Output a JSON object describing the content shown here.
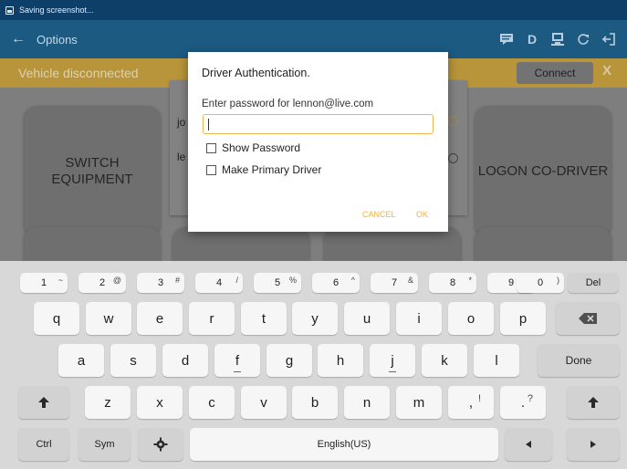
{
  "status_bar": {
    "text": "Saving screenshot..."
  },
  "app_bar": {
    "back_glyph": "←",
    "title": "Options",
    "actions": [
      "message-icon",
      "D",
      "eld-icon",
      "refresh-icon",
      "logout-icon"
    ],
    "d_label": "D"
  },
  "alert_bar": {
    "message": "Vehicle disconnected",
    "connect_label": "Connect",
    "close_label": "X"
  },
  "tiles": {
    "switch_equipment": "SWITCH\nEQUIPMENT",
    "logon_codriver": "LOGON CO-DRIVER"
  },
  "background_list": {
    "item1_fragment": "jo",
    "item2_fragment": "le"
  },
  "dialog": {
    "title": "Driver Authentication.",
    "prompt": "Enter password for lennon@live.com",
    "password_value": "",
    "show_password_label": "Show Password",
    "primary_driver_label": "Make Primary Driver",
    "cancel_label": "CANCEL",
    "ok_label": "OK"
  },
  "keyboard": {
    "row1": [
      {
        "k": "1",
        "s": "~"
      },
      {
        "k": "2",
        "s": "@"
      },
      {
        "k": "3",
        "s": "#"
      },
      {
        "k": "4",
        "s": "/"
      },
      {
        "k": "5",
        "s": "%"
      },
      {
        "k": "6",
        "s": "^"
      },
      {
        "k": "7",
        "s": "&"
      },
      {
        "k": "8",
        "s": "*"
      },
      {
        "k": "9",
        "s": "("
      },
      {
        "k": "0",
        "s": ")"
      }
    ],
    "del_label": "Del",
    "row2": [
      "q",
      "w",
      "e",
      "r",
      "t",
      "y",
      "u",
      "i",
      "o",
      "p"
    ],
    "row3": [
      "a",
      "s",
      "d",
      "f",
      "g",
      "h",
      "j",
      "k",
      "l"
    ],
    "done_label": "Done",
    "row4": [
      {
        "k": "z",
        "s": ""
      },
      {
        "k": "x",
        "s": ""
      },
      {
        "k": "c",
        "s": ""
      },
      {
        "k": "v",
        "s": ""
      },
      {
        "k": "b",
        "s": ""
      },
      {
        "k": "n",
        "s": ""
      },
      {
        "k": "m",
        "s": ""
      },
      {
        "k": ",",
        "s": "!"
      },
      {
        "k": ".",
        "s": "?"
      }
    ],
    "ctrl_label": "Ctrl",
    "sym_label": "Sym",
    "space_label": "English(US)"
  },
  "colors": {
    "app_bar": "#1c5a82",
    "alert_bar": "#b8953a",
    "accent": "#f3b23c"
  }
}
